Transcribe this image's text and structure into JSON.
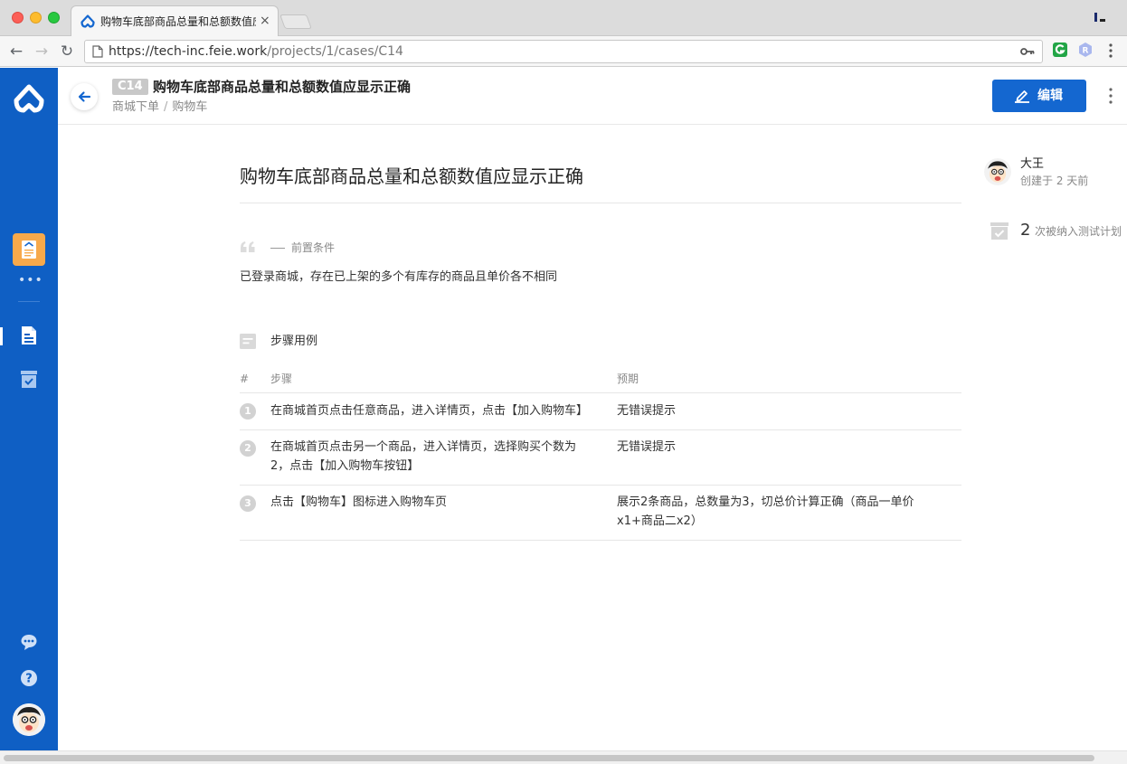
{
  "browser": {
    "tab_title": "购物车底部商品总量和总额数值应显示正确",
    "tab_close": "×",
    "url_host": "https://tech-inc.feie.work",
    "url_path": "/projects/1/cases/C14",
    "back": "←",
    "forward": "→",
    "reload": "↻"
  },
  "header": {
    "case_id": "C14",
    "title": "购物车底部商品总量和总额数值应显示正确",
    "breadcrumb": [
      "商城下单",
      "购物车"
    ],
    "breadcrumb_sep": "/",
    "edit_label": "编辑"
  },
  "main": {
    "title": "购物车底部商品总量和总额数值应显示正确",
    "precondition_label": "前置条件",
    "precondition_text": "已登录商城，存在已上架的多个有库存的商品且单价各不相同",
    "steps_label": "步骤用例",
    "steps_headers": {
      "num": "#",
      "step": "步骤",
      "expected": "预期"
    },
    "steps": [
      {
        "num": "1",
        "step": "在商城首页点击任意商品，进入详情页，点击【加入购物车】",
        "expected": "无错误提示"
      },
      {
        "num": "2",
        "step": "在商城首页点击另一个商品，进入详情页，选择购买个数为2，点击【加入购物车按钮】",
        "expected": "无错误提示"
      },
      {
        "num": "3",
        "step": "点击【购物车】图标进入购物车页",
        "expected": "展示2条商品，总数量为3，切总价计算正确（商品一单价x1+商品二x2）"
      }
    ]
  },
  "info": {
    "author_name": "大王",
    "author_meta": "创建于 2 天前",
    "plan_count": "2",
    "plan_label": "次被纳入测试计划"
  },
  "sidebar": {
    "dots": "•••"
  },
  "colors": {
    "brand": "#0f5fc4",
    "primary_button": "#1467d0",
    "project_tile": "#f7a94b"
  },
  "icons": [
    "logo-icon",
    "project-icon",
    "case-list-icon",
    "test-plan-icon",
    "chat-icon",
    "help-icon",
    "pencil-icon",
    "more-vertical-icon",
    "quote-icon",
    "steps-icon",
    "back-arrow-icon",
    "key-icon"
  ]
}
